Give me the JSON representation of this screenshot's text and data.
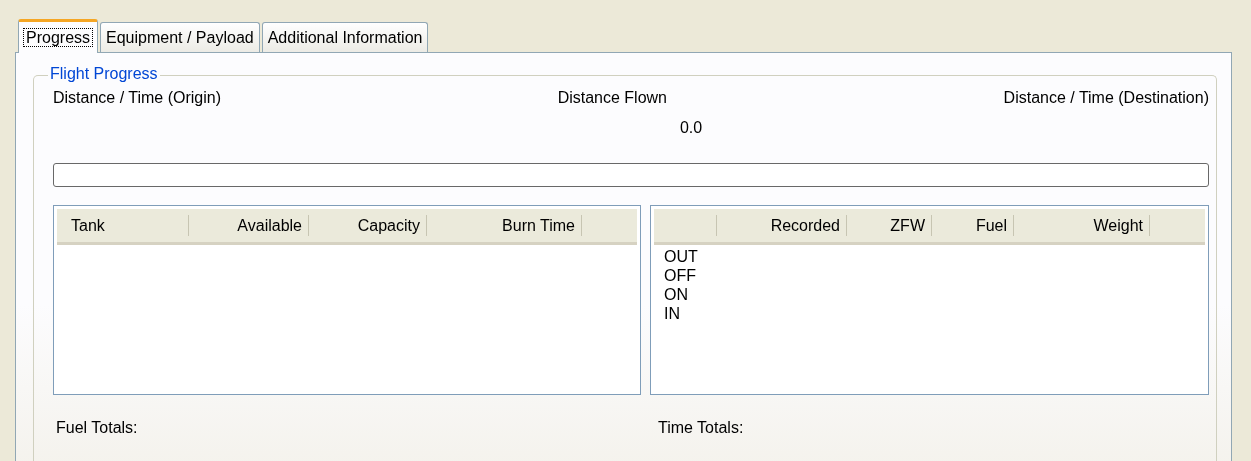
{
  "tabs": [
    {
      "label": "Progress",
      "selected": true
    },
    {
      "label": "Equipment / Payload",
      "selected": false
    },
    {
      "label": "Additional Information",
      "selected": false
    }
  ],
  "group": {
    "title": "Flight Progress",
    "labels": [
      "Distance / Time (Origin)",
      "Distance Flown",
      "Distance / Time (Destination)"
    ],
    "distance_flown": "0.0",
    "progress": {
      "level": 0
    },
    "tank_list": {
      "columns": [
        "Tank",
        "Available",
        "Capacity",
        "Burn Time"
      ]
    },
    "times_list": {
      "columns": [
        "Recorded",
        "ZFW",
        "Fuel",
        "Weight"
      ],
      "rows": [
        "OUT",
        "OFF",
        "ON",
        "IN"
      ]
    },
    "fuel_totals": "Fuel Totals:",
    "time_totals": "Time Totals:"
  }
}
